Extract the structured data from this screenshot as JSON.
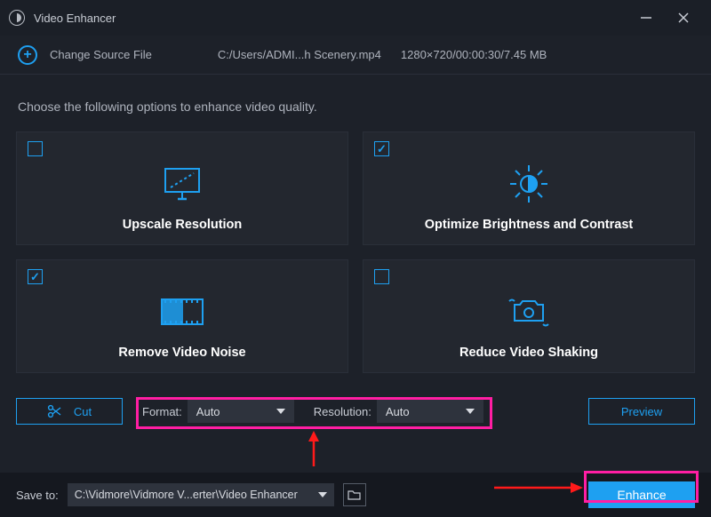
{
  "window": {
    "title": "Video Enhancer"
  },
  "source": {
    "change_label": "Change Source File",
    "path": "C:/Users/ADMI...h Scenery.mp4",
    "info": "1280×720/00:00:30/7.45 MB"
  },
  "prompt_text": "Choose the following options to enhance video quality.",
  "cards": {
    "upscale": {
      "title": "Upscale Resolution",
      "checked": false
    },
    "brightness": {
      "title": "Optimize Brightness and Contrast",
      "checked": true
    },
    "noise": {
      "title": "Remove Video Noise",
      "checked": true
    },
    "shaking": {
      "title": "Reduce Video Shaking",
      "checked": false
    }
  },
  "controls": {
    "cut_label": "Cut",
    "format_label": "Format:",
    "format_value": "Auto",
    "resolution_label": "Resolution:",
    "resolution_value": "Auto",
    "preview_label": "Preview"
  },
  "footer": {
    "save_label": "Save to:",
    "save_path": "C:\\Vidmore\\Vidmore V...erter\\Video Enhancer",
    "enhance_label": "Enhance"
  }
}
